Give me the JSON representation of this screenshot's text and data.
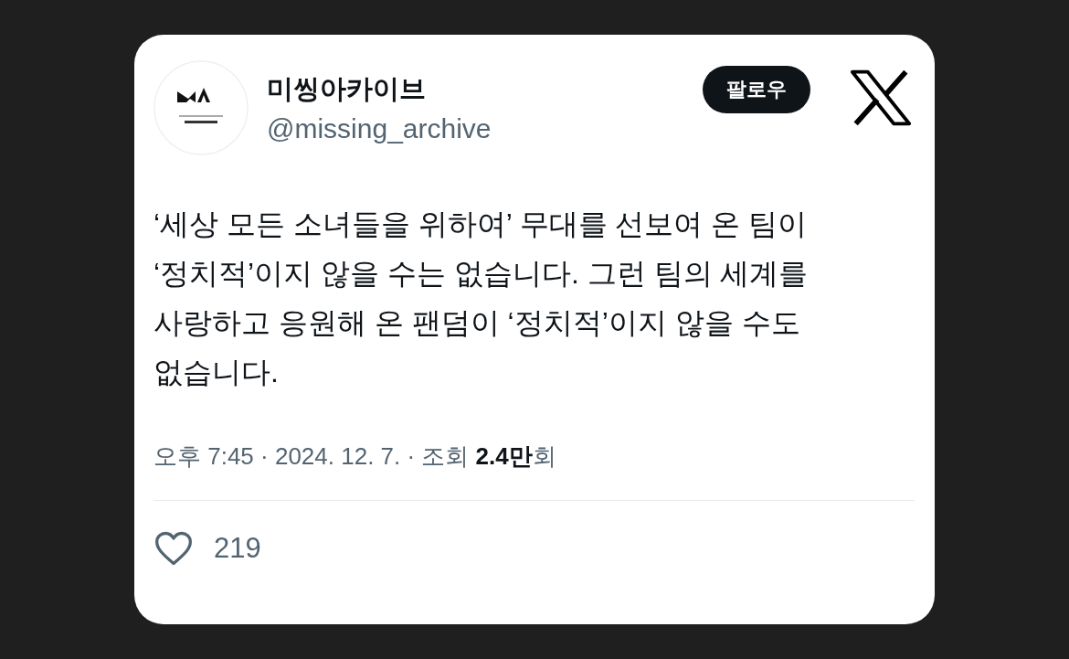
{
  "post": {
    "author": {
      "name": "미씽아카이브",
      "handle": "@missing_archive"
    },
    "follow_button": {
      "label": "팔로우"
    },
    "body": "‘세상 모든 소녀들을 위하여’ 무대를 선보여 온 팀이\n‘정치적’이지 않을 수는 없습니다. 그런 팀의 세계를\n사랑하고 응원해 온 팬덤이 ‘정치적’이지 않을 수도\n없습니다.",
    "meta": "오후 7:45 · 2024. 12. 7. · 조회 **2.4만**회",
    "likes": "219"
  }
}
